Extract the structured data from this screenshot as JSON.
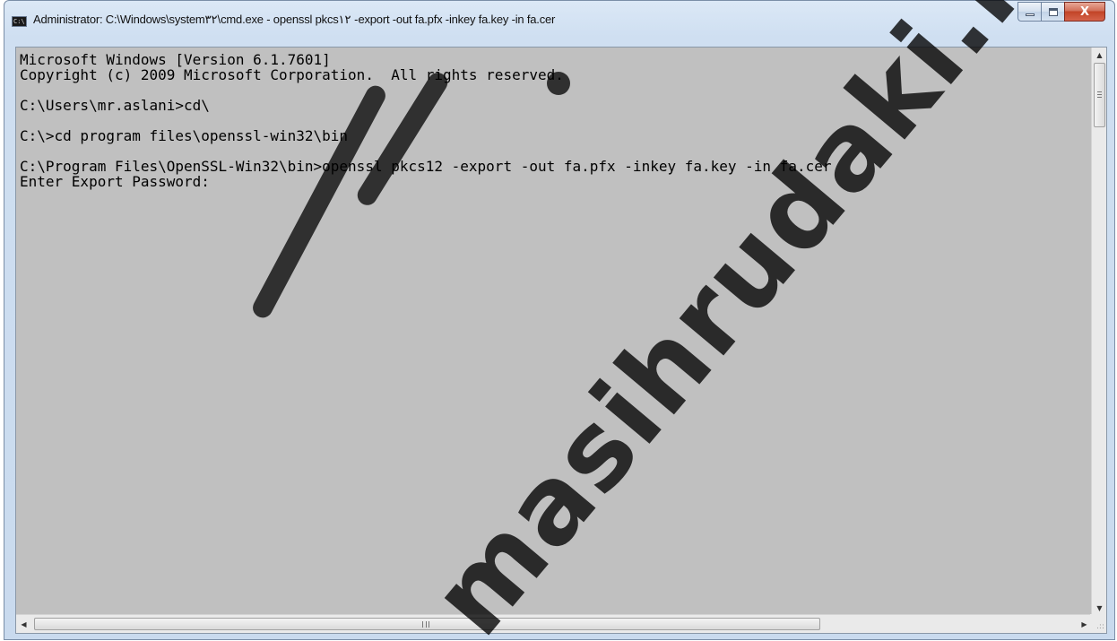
{
  "window": {
    "title": "Administrator: C:\\Windows\\system۳۲\\cmd.exe - openssl  pkcs۱۲ -export -out fa.pfx -inkey fa.key -in fa.cer",
    "icon": "cmd-console-icon",
    "icon_label": "C:\\"
  },
  "caption_buttons": {
    "minimize": "minimize-icon",
    "maximize": "maximize-icon",
    "close_label": "X"
  },
  "console": {
    "lines": [
      "Microsoft Windows [Version 6.1.7601]",
      "Copyright (c) 2009 Microsoft Corporation.  All rights reserved.",
      "",
      "C:\\Users\\mr.aslani>cd\\",
      "",
      "C:\\>cd program files\\openssl-win32\\bin",
      "",
      "C:\\Program Files\\OpenSSL-Win32\\bin>openssl pkcs12 -export -out fa.pfx -inkey fa.key -in fa.cer",
      "Enter Export Password:"
    ],
    "background": "#c0c0c0",
    "foreground": "#000000"
  },
  "scrollbars": {
    "up_arrow": "▲",
    "down_arrow": "▼",
    "left_arrow": "◀",
    "right_arrow": "▶",
    "size_grip": ".::"
  },
  "watermark": {
    "text": "masihrudaki.ir"
  }
}
